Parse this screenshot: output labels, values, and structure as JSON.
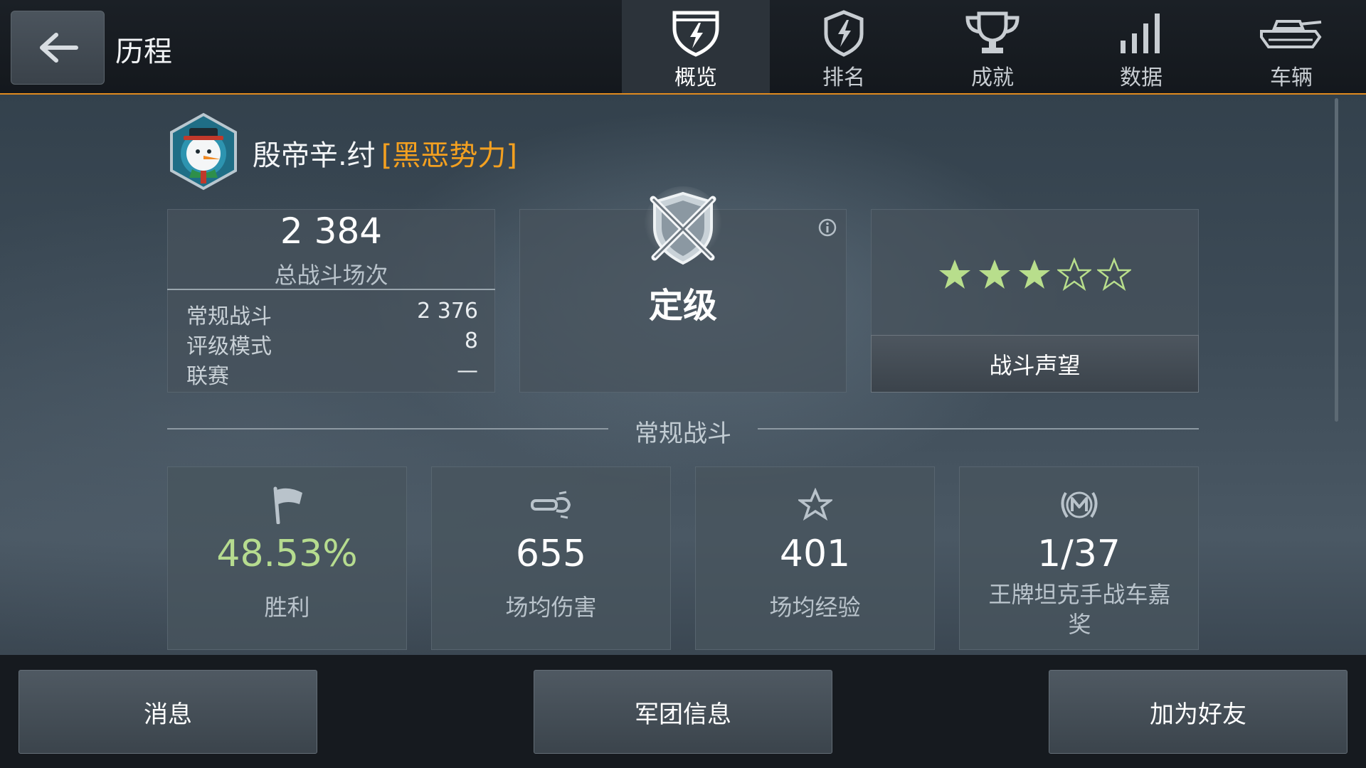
{
  "header": {
    "title": "历程",
    "tabs": [
      {
        "label": "概览",
        "icon": "shield-lightning-icon",
        "active": true
      },
      {
        "label": "排名",
        "icon": "rating-badge-icon",
        "active": false
      },
      {
        "label": "成就",
        "icon": "trophy-icon",
        "active": false
      },
      {
        "label": "数据",
        "icon": "bar-stats-icon",
        "active": false
      },
      {
        "label": "车辆",
        "icon": "tank-icon",
        "active": false
      }
    ]
  },
  "player": {
    "name": "殷帝辛.纣",
    "clan": "[黑恶势力]"
  },
  "battles": {
    "total": "2 384",
    "total_label": "总战斗场次",
    "rows": [
      {
        "label": "常规战斗",
        "value": "2 376"
      },
      {
        "label": "评级模式",
        "value": "8"
      },
      {
        "label": "联赛",
        "value": "—"
      }
    ]
  },
  "rank": {
    "label": "定级",
    "icon": "crossed-swords-shield-icon"
  },
  "reputation": {
    "stars_filled": 3,
    "stars_total": 5,
    "button_label": "战斗声望"
  },
  "section": {
    "title": "常规战斗"
  },
  "stats": [
    {
      "icon": "flag-icon",
      "value": "48.53%",
      "label": "胜利"
    },
    {
      "icon": "shell-damage-icon",
      "value": "655",
      "label": "场均伤害"
    },
    {
      "icon": "star-outline-icon",
      "value": "401",
      "label": "场均经验"
    },
    {
      "icon": "mastery-badge-icon",
      "value": "1/37",
      "label": "王牌坦克手战车嘉奖"
    }
  ],
  "footer": {
    "message_label": "消息",
    "clan_info_label": "军团信息",
    "add_friend_label": "加为好友"
  },
  "colors": {
    "accent": "#e08a1e",
    "clan_tag": "#f3a020",
    "winrate": "#b6dc8f",
    "star": "#b8de8c"
  }
}
